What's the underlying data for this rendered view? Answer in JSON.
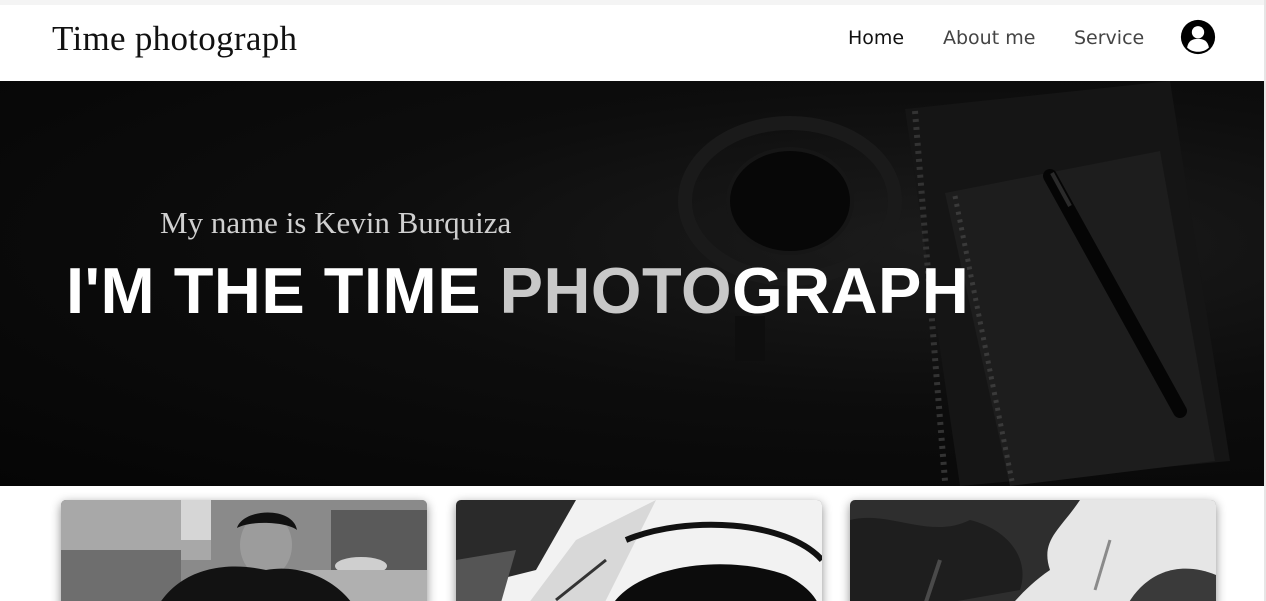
{
  "header": {
    "brand": "Time photograph",
    "nav": {
      "home": "Home",
      "about": "About me",
      "service": "Service"
    },
    "account_icon": "user-circle-icon"
  },
  "hero": {
    "subtitle": "My name is Kevin Burquiza",
    "headline_white": "I'M THE TIME ",
    "headline_grey": "PHOTO",
    "headline_white2": "GRAPH"
  },
  "gallery": {
    "cards": [
      {
        "image": "portrait-photo"
      },
      {
        "image": "selfie-photo"
      },
      {
        "image": "trees-photo"
      }
    ]
  },
  "colors": {
    "hero_bg": "#080808",
    "headline": "#ffffff",
    "headline_accent": "#c8c8c8",
    "subtitle": "#d0d0d0"
  }
}
